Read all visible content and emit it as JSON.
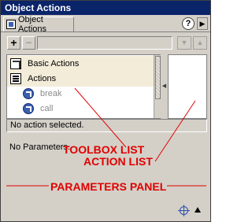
{
  "window": {
    "title": "Object Actions"
  },
  "tabs": [
    {
      "label": "Object Actions"
    }
  ],
  "header": {
    "help_glyph": "?",
    "menu_glyph": "▶"
  },
  "toolbar": {
    "add_glyph": "+",
    "remove_glyph": "−",
    "down_glyph": "▼",
    "up_glyph": "▲"
  },
  "toolbox": {
    "items": [
      {
        "label": "Basic Actions",
        "icon": "book-icon"
      },
      {
        "label": "Actions",
        "icon": "pages-icon"
      },
      {
        "label": "break",
        "icon": "action-icon"
      },
      {
        "label": "call",
        "icon": "action-icon"
      }
    ]
  },
  "splitter": {
    "glyph": "◀"
  },
  "status": {
    "text": "No action selected."
  },
  "parameters": {
    "text": "No Parameters."
  },
  "annotations": {
    "toolbox_list": "TOOLBOX LIST",
    "action_list": "ACTION LIST",
    "parameters_panel": "PARAMETERS PANEL",
    "color": "#e00000"
  },
  "colors": {
    "titlebar": "#0a246a",
    "panel": "#d4d0c8",
    "highlight": "#f3ecd9"
  }
}
